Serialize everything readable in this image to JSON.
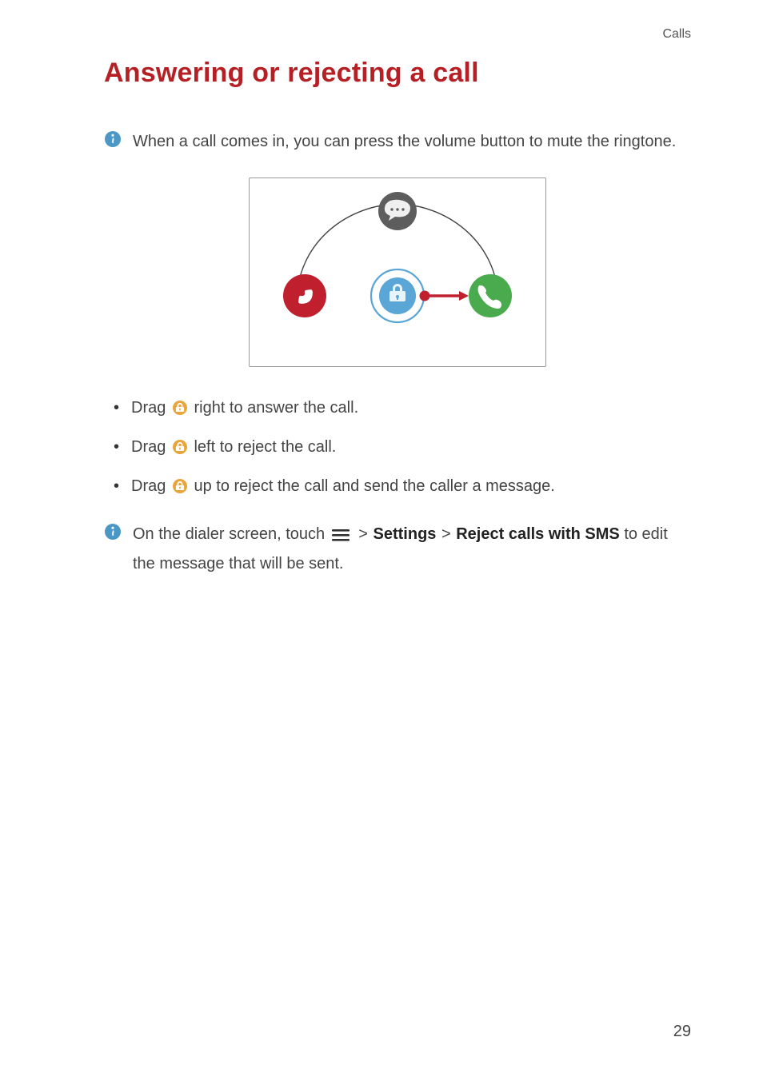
{
  "runningHead": "Calls",
  "title": "Answering or rejecting a call",
  "tip1": "When a call comes in, you can press the volume button to mute the ringtone.",
  "action1_pre": "Drag ",
  "action1_post": " right to answer the call.",
  "action2_pre": "Drag ",
  "action2_post": " left to reject the call.",
  "action3_pre": "Drag ",
  "action3_post": " up to reject the call and send the caller a message.",
  "tip2_pre": "On the dialer screen, touch ",
  "tip2_settings": "Settings",
  "tip2_reject": "Reject calls with SMS",
  "tip2_post": " to edit the message that will be sent.",
  "gt": ">",
  "pageNumber": "29"
}
